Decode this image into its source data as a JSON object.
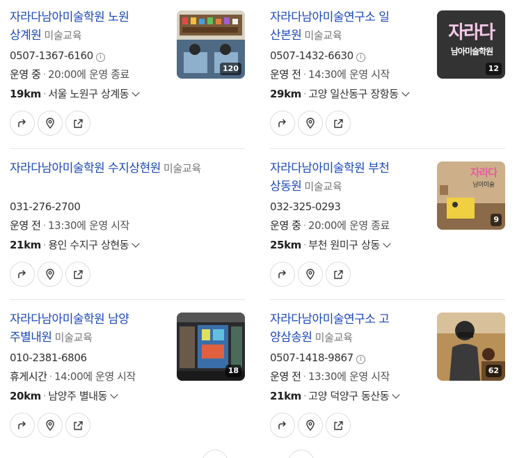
{
  "results": [
    {
      "name": "자라다남아미술학원 노원상계원",
      "name_line1": "자라다남아미술학원 노원",
      "name_line2": "상계원",
      "category": "미술교육",
      "phone": "0507-1367-6160",
      "phone_info": "i",
      "status": "운영 중",
      "hours": "20:00에 운영 종료",
      "distance": "19km",
      "address": "서울 노원구 상계동",
      "photo_count": "120",
      "photo_icon": "classroom-photo"
    },
    {
      "name": "자라다남아미술연구소 일산본원",
      "name_line1": "자라다남아미술연구소 일",
      "name_line2": "산본원",
      "category": "미술교육",
      "phone": "0507-1432-6630",
      "phone_info": "i",
      "status": "운영 전",
      "hours": "14:30에 운영 시작",
      "distance": "29km",
      "address": "고양 일산동구 장항동",
      "photo_count": "12",
      "photo_logo_line1": "자라다",
      "photo_logo_line2": "남아미술학원"
    },
    {
      "name": "자라다남아미술학원 수지상현원",
      "name_line1": "자라다남아미술학원 수지상현원",
      "name_line2": "",
      "category": "미술교육",
      "phone": "031-276-2700",
      "status": "운영 전",
      "hours": "13:30에 운영 시작",
      "distance": "21km",
      "address": "용인 수지구 상현동"
    },
    {
      "name": "자라다남아미술학원 부천상동원",
      "name_line1": "자라다남아미술학원 부천",
      "name_line2": "상동원",
      "category": "미술교육",
      "phone": "032-325-0293",
      "status": "운영 중",
      "hours": "20:00에 운영 종료",
      "distance": "25km",
      "address": "부천 원미구 상동",
      "photo_count": "9",
      "photo_logo_line1": "자라다",
      "photo_logo_line2": "남아미술"
    },
    {
      "name": "자라다남아미술학원 남양주별내원",
      "name_line1": "자라다남아미술학원 남양",
      "name_line2": "주별내원",
      "category": "미술교육",
      "phone": "010-2381-6806",
      "status": "휴게시간",
      "hours": "14:00에 운영 시작",
      "distance": "20km",
      "address": "남양주 별내동",
      "photo_count": "18"
    },
    {
      "name": "자라다남아미술연구소 고양삼송원",
      "name_line1": "자라다남아미술연구소 고",
      "name_line2": "양삼송원",
      "category": "미술교육",
      "phone": "0507-1418-9867",
      "phone_info": "i",
      "status": "운영 전",
      "hours": "13:30에 운영 시작",
      "distance": "21km",
      "address": "고양 덕양구 동산동",
      "photo_count": "62"
    }
  ],
  "actions": {
    "directions_icon": "directions-arrow-icon",
    "map_icon": "map-pin-icon",
    "share_icon": "share-icon"
  },
  "colors": {
    "title": "#1a47b8",
    "category": "#767676",
    "divider": "#e6e6e6"
  }
}
